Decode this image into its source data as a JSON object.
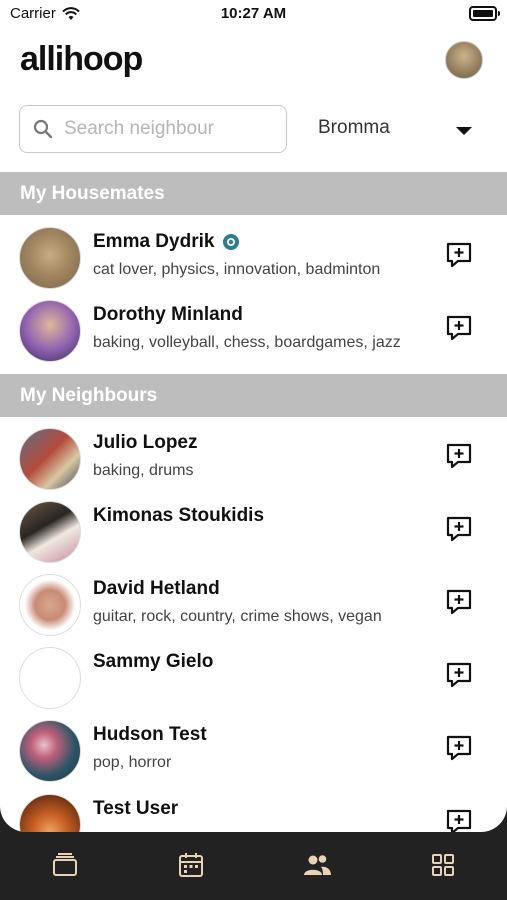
{
  "status_bar": {
    "carrier": "Carrier",
    "time": "10:27 AM"
  },
  "app": {
    "logo": "allihoop"
  },
  "search": {
    "placeholder": "Search neighbour"
  },
  "area_select": {
    "selected": "Bromma"
  },
  "housemates": {
    "title": "My Housemates",
    "people": [
      {
        "name": "Emma Dydrik",
        "interests": "cat lover, physics, innovation, badminton",
        "verified": true
      },
      {
        "name": "Dorothy Minland",
        "interests": "baking, volleyball, chess, boardgames, jazz"
      }
    ]
  },
  "neighbours": {
    "title": "My Neighbours",
    "people": [
      {
        "name": "Julio Lopez",
        "interests": "baking, drums"
      },
      {
        "name": "Kimonas Stoukidis",
        "interests": ""
      },
      {
        "name": "David Hetland",
        "interests": "guitar, rock, country, crime shows, vegan"
      },
      {
        "name": "Sammy Gielo",
        "interests": ""
      },
      {
        "name": "Hudson Test",
        "interests": "pop, horror"
      },
      {
        "name": "Test User",
        "interests": ""
      }
    ]
  },
  "tab_bar": {
    "tabs": [
      {
        "icon": "cards-icon",
        "active": false
      },
      {
        "icon": "calendar-icon",
        "active": false
      },
      {
        "icon": "people-icon",
        "active": true
      },
      {
        "icon": "grid-icon",
        "active": false
      }
    ]
  },
  "colors": {
    "tab_icon": "#e8d3b6",
    "section_header": "#bdbdbd",
    "badge": "#2a7f8f",
    "tab_bar_bg": "#222222"
  }
}
